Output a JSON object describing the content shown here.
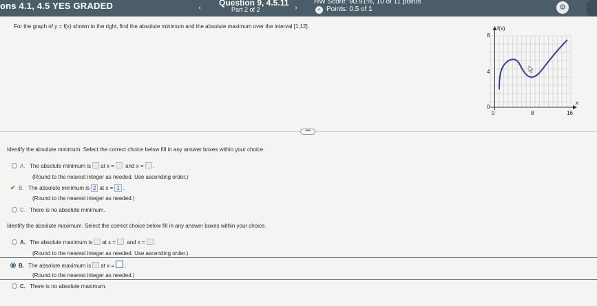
{
  "header": {
    "title": "ons 4.1, 4.5 YES GRADED",
    "question": "Question 9, 4.5.11",
    "part": "Part 2 of 2",
    "hw_score": "HW Score: 90.91%, 10 of 11 points",
    "points": "Points: 0.5 of 1",
    "nav_prev": "‹",
    "nav_next": "›"
  },
  "question_text": "For the graph of y = f(x) shown to the right, find the absolute minimum and the absolute maximum over the interval [1,12].",
  "graph": {
    "y_label": "f(x)",
    "x_label": "x",
    "y_ticks": [
      "8",
      "4",
      "0"
    ],
    "x_ticks": [
      "0",
      "8",
      "16"
    ]
  },
  "more_button": "•••",
  "minimum": {
    "prompt": "Identify the absolute minimum. Select the correct choice below fill in any answer boxes within your choice.",
    "a_letter": "A.",
    "a_text1": "The absolute minimum is",
    "a_text2": "at x =",
    "a_text3": "and x =",
    "a_text4": ".",
    "a_note": "(Round to the nearest integer as needed. Use ascending order.)",
    "b_letter": "B.",
    "b_text1": "The absolute minimum is",
    "b_value": "2",
    "b_text2": "at x =",
    "b_x": "1",
    "b_text3": ".",
    "b_note": "(Round to the nearest integer as needed.)",
    "c_letter": "C.",
    "c_text": "There is no absolute minimum."
  },
  "maximum": {
    "prompt": "Identify the absolute maximum. Select the correct choice below fill in any answer boxes within your choice.",
    "a_letter": "A.",
    "a_text1": "The absolute maximum is",
    "a_text2": "at x =",
    "a_text3": "and x =",
    "a_text4": ".",
    "a_note": "(Round to the nearest integer as needed. Use ascending order.)",
    "b_letter": "B.",
    "b_text1": "The absolute maximum is",
    "b_text2": "at x =",
    "b_text3": ".",
    "b_note": "(Round to the nearest integer as needed.)",
    "c_letter": "C.",
    "c_text": "There is no absolute maximum."
  }
}
